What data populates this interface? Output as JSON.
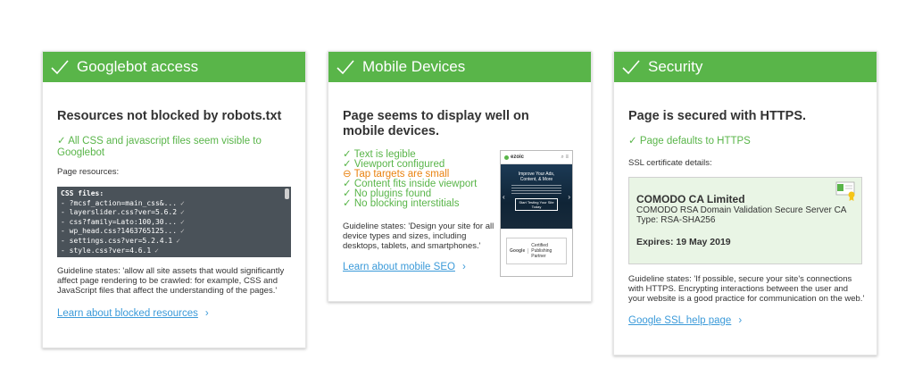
{
  "cards": {
    "googlebot": {
      "header": "Googlebot access",
      "title": "Resources not blocked by robots.txt",
      "status": "All CSS and javascript files seem visible to Googlebot",
      "resources_label": "Page resources:",
      "code_lines": [
        "CSS files:",
        "- ?mcsf_action=main_css&...",
        "- layerslider.css?ver=5.6.2",
        "- css?family=Lato:100,30...",
        "- wp_head.css?1463765125...",
        "- settings.css?ver=5.2.4.1",
        "- style.css?ver=4.6.1"
      ],
      "guideline": "Guideline states: 'allow all site assets that would significantly affect page rendering to be crawled: for example, CSS and JavaScript files that affect the understanding of the pages.'",
      "link": "Learn about blocked resources"
    },
    "mobile": {
      "header": "Mobile Devices",
      "title": "Page seems to display well on mobile devices.",
      "checks": [
        {
          "text": "Text is legible",
          "status": "ok"
        },
        {
          "text": "Viewport configured",
          "status": "ok"
        },
        {
          "text": "Tap targets are small",
          "status": "warn"
        },
        {
          "text": "Content fits inside viewport",
          "status": "ok"
        },
        {
          "text": "No plugins found",
          "status": "ok"
        },
        {
          "text": "No blocking interstitials",
          "status": "ok"
        }
      ],
      "guideline": "Guideline states: 'Design your site for all device types and sizes, including desktops, tablets, and smartphones.'",
      "link": "Learn about mobile SEO",
      "phone": {
        "logo": "ezoic",
        "hero_text": "Improve Your Ads, Content, & More",
        "cta": "Start Testing Your Site Today",
        "badge_google": "Google",
        "badge_text": "Certified Publishing Partner"
      }
    },
    "security": {
      "header": "Security",
      "title": "Page is secured with HTTPS.",
      "status": "Page defaults to HTTPS",
      "details_label": "SSL certificate details:",
      "cert": {
        "issuer": "COMODO CA Limited",
        "name": "COMODO RSA Domain Validation Secure Server CA",
        "type": "Type: RSA-SHA256",
        "expires": "Expires: 19 May 2019"
      },
      "guideline": "Guideline states: 'If possible, secure your site's connections with HTTPS. Encrypting interactions between the user and your website is a good practice for communication on the web.'",
      "link": "Google SSL help page"
    }
  },
  "colors": {
    "header_green": "#59b549",
    "link_blue": "#3b9ad9",
    "warn_orange": "#e9820f"
  }
}
